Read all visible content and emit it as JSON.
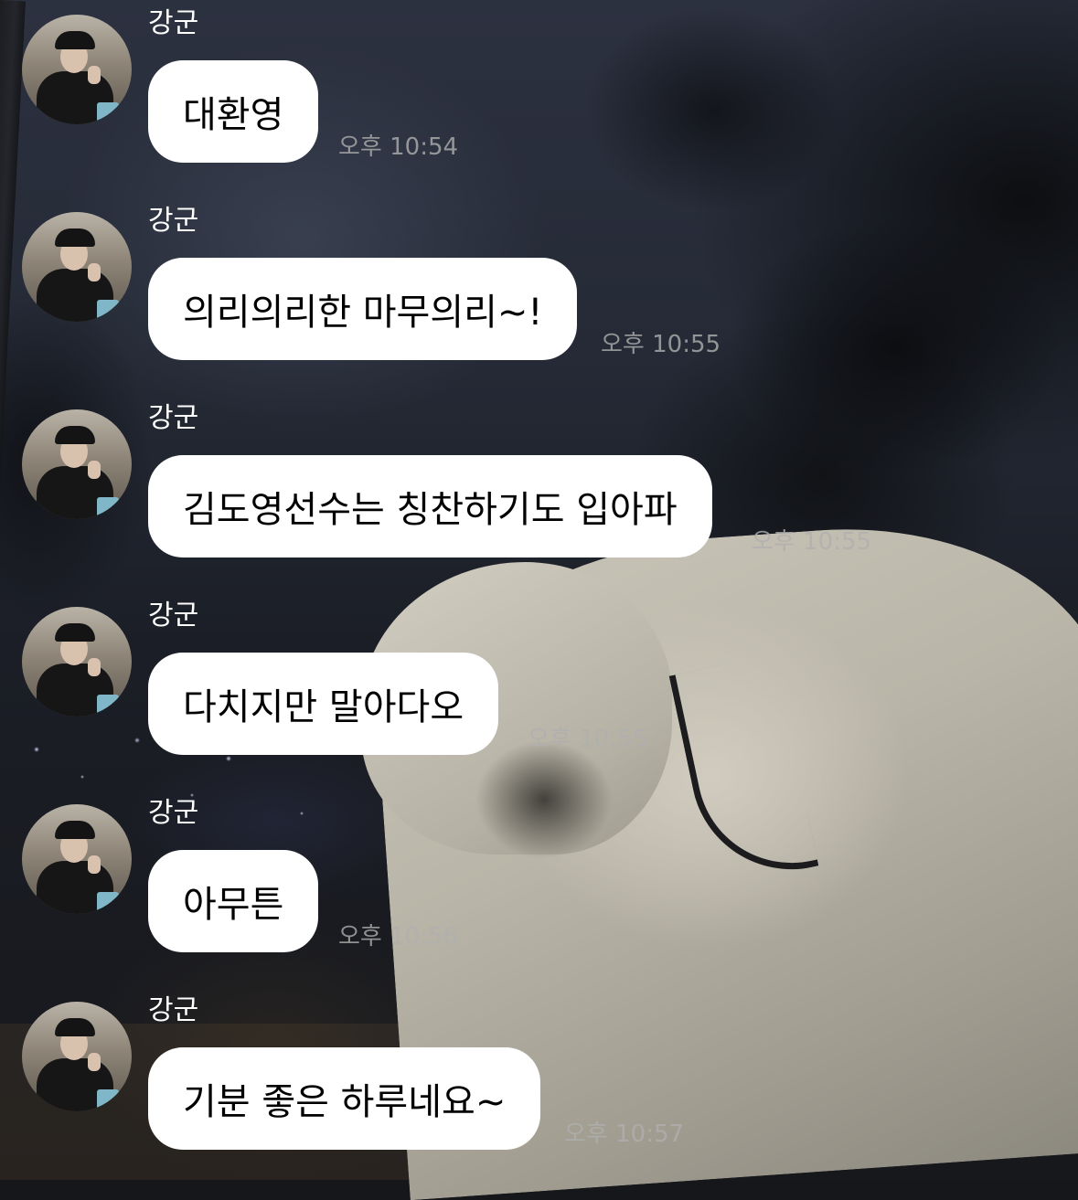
{
  "messages": [
    {
      "sender": "강군",
      "text": "대환영",
      "time": "오후 10:54"
    },
    {
      "sender": "강군",
      "text": "의리의리한 마무의리~!",
      "time": "오후 10:55"
    },
    {
      "sender": "강군",
      "text": "김도영선수는 칭찬하기도 입아파",
      "time": "오후 10:55"
    },
    {
      "sender": "강군",
      "text": "다치지만 말아다오",
      "time": "오후 10:55"
    },
    {
      "sender": "강군",
      "text": "아무튼",
      "time": "오후 10:56"
    },
    {
      "sender": "강군",
      "text": "기분 좋은 하루네요~",
      "time": "오후 10:57"
    }
  ],
  "colors": {
    "bubble": "#ffffff",
    "bubble_text": "#000000",
    "sender_text": "#ffffff",
    "time_text": "#afafaf"
  },
  "icons": {
    "avatar": "profile-photo-man-black-cap"
  }
}
